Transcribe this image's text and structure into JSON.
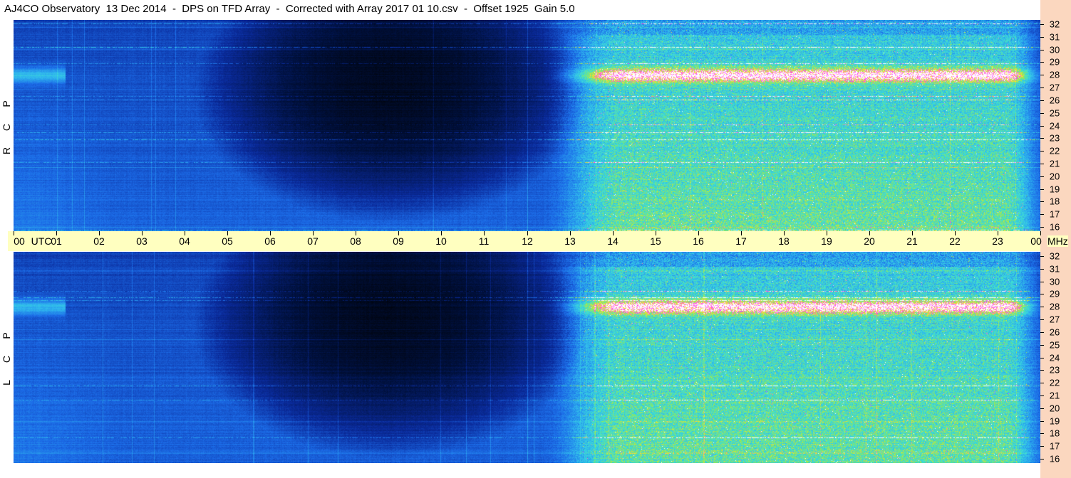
{
  "title": "AJ4CO Observatory  13 Dec 2014  -  DPS on TFD Array  -  Corrected with Array 2017 01 10.csv  -  Offset 1925  Gain 5.0",
  "chart_data": {
    "type": "heatmap",
    "title": "AJ4CO Observatory  13 Dec 2014  -  DPS on TFD Array  -  Corrected with Array 2017 01 10.csv  -  Offset 1925  Gain 5.0",
    "x_unit": "UTC",
    "x_ticks": [
      "00",
      "01",
      "02",
      "03",
      "04",
      "05",
      "06",
      "07",
      "08",
      "09",
      "10",
      "11",
      "12",
      "13",
      "14",
      "15",
      "16",
      "17",
      "18",
      "19",
      "20",
      "21",
      "22",
      "23",
      "00"
    ],
    "xlim": [
      0,
      24
    ],
    "y_unit": "MHz",
    "y_ticks": [
      "16",
      "17",
      "18",
      "19",
      "20",
      "21",
      "22",
      "23",
      "24",
      "25",
      "26",
      "27",
      "28",
      "29",
      "30",
      "31",
      "32"
    ],
    "ylim": [
      16,
      32
    ],
    "panels": [
      {
        "id": "rcp",
        "letters": [
          "R",
          "C",
          "P"
        ]
      },
      {
        "id": "lcp",
        "letters": [
          "L",
          "C",
          "P"
        ]
      }
    ],
    "colors": {
      "low": "#000814",
      "background": "#0a2a9a",
      "medium": "#3fd2e6",
      "high": "#7fe060",
      "peak": "#ff30ff",
      "saturated": "#ffffff",
      "axis_band": "#ffffc0",
      "frequency_strip": "#fbd7bf"
    }
  }
}
